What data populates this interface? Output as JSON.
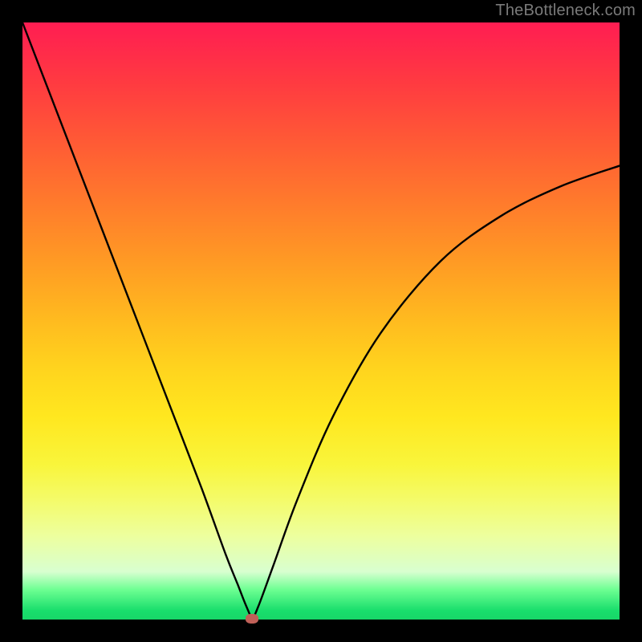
{
  "watermark": "TheBottleneck.com",
  "chart_data": {
    "type": "line",
    "title": "",
    "xlabel": "",
    "ylabel": "",
    "xlim": [
      0,
      100
    ],
    "ylim": [
      0,
      100
    ],
    "series": [
      {
        "name": "curve",
        "x": [
          0,
          5,
          10,
          15,
          20,
          25,
          30,
          34,
          36,
          37.5,
          38.5,
          39.5,
          42,
          46,
          52,
          60,
          70,
          80,
          90,
          100
        ],
        "y": [
          100,
          87,
          74,
          61,
          48,
          35,
          22,
          11,
          6,
          2.2,
          0.4,
          2.2,
          9,
          20,
          34,
          48,
          60,
          67.5,
          72.5,
          76
        ]
      }
    ],
    "marker": {
      "x": 38.5,
      "y": 0.2
    },
    "gradient_stops": [
      {
        "pos": 0.0,
        "color": "#ff1d52"
      },
      {
        "pos": 0.5,
        "color": "#ffbb1f"
      },
      {
        "pos": 0.74,
        "color": "#f9f53b"
      },
      {
        "pos": 0.95,
        "color": "#6dff92"
      },
      {
        "pos": 1.0,
        "color": "#17d668"
      }
    ]
  },
  "layout": {
    "image_size": 800,
    "margin": 28,
    "plot_size": 744
  }
}
